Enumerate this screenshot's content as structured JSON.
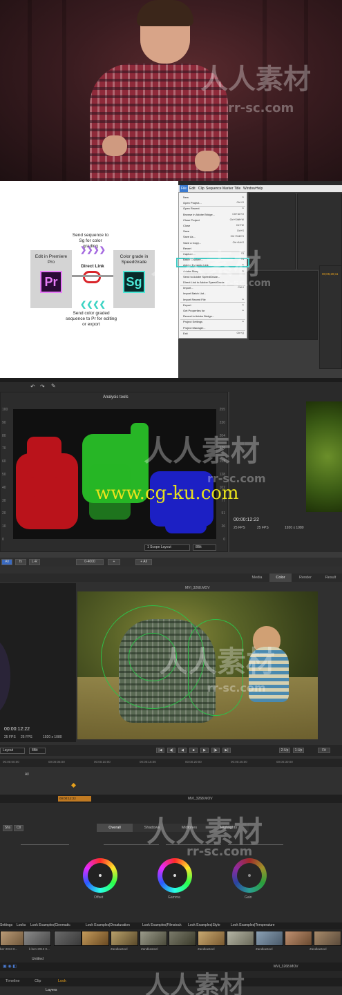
{
  "watermark": {
    "chinese": "人人素材",
    "url": "rr-sc.com",
    "overlay_url": "www.cg-ku.com"
  },
  "premiere": {
    "diagram": {
      "send_top": "Send sequence to Sg for color grading",
      "edit_in": "Edit in Premiere Pro",
      "direct_link": "Direct Link",
      "color_grade_in": "Color grade in SpeedGrade",
      "send_bottom": "Send color graded sequence to Pr for editing or export",
      "pr_icon": "Pr",
      "sg_icon": "Sg"
    },
    "menubar": [
      "File",
      "Edit",
      "Clip",
      "Sequence",
      "Marker",
      "Title",
      "Window",
      "Help"
    ],
    "file_menu": [
      {
        "label": "New",
        "shortcut": "▸"
      },
      {
        "label": "Open Project...",
        "shortcut": "Ctrl+O"
      },
      {
        "label": "Open Recent",
        "shortcut": "▸"
      },
      {
        "label": "Browse in Adobe Bridge...",
        "shortcut": "Ctrl+Alt+O"
      },
      {
        "label": "Close Project",
        "shortcut": "Ctrl+Shift+W"
      },
      {
        "label": "Close",
        "shortcut": "Ctrl+W"
      },
      {
        "label": "Save",
        "shortcut": "Ctrl+S"
      },
      {
        "label": "Save As...",
        "shortcut": "Ctrl+Shift+S"
      },
      {
        "label": "Save a Copy...",
        "shortcut": "Ctrl+Alt+S"
      },
      {
        "label": "Revert",
        "shortcut": ""
      },
      {
        "label": "Capture...",
        "shortcut": "F5"
      },
      {
        "label": "Batch Capture...",
        "shortcut": "F6"
      },
      {
        "label": "Adobe Dynamic Link",
        "shortcut": "▸"
      },
      {
        "label": "Adobe Story",
        "shortcut": "▸"
      },
      {
        "label": "Send to Adobe SpeedGrade...",
        "shortcut": ""
      },
      {
        "label": "Direct Link to Adobe SpeedGrade",
        "shortcut": ""
      },
      {
        "label": "Import...",
        "shortcut": "Ctrl+I"
      },
      {
        "label": "Import Batch List...",
        "shortcut": ""
      },
      {
        "label": "Import Recent File",
        "shortcut": "▸"
      },
      {
        "label": "Export",
        "shortcut": "▸"
      },
      {
        "label": "Get Properties for",
        "shortcut": "▸"
      },
      {
        "label": "Reveal in Adobe Bridge...",
        "shortcut": ""
      },
      {
        "label": "Project Settings",
        "shortcut": "▸"
      },
      {
        "label": "Project Manager...",
        "shortcut": ""
      },
      {
        "label": "Exit",
        "shortcut": "Ctrl+Q"
      }
    ],
    "timecode": "00;05;28;11"
  },
  "speedgrade_scopes": {
    "panel_title": "Analysis tools",
    "axis_left": [
      "100",
      "90",
      "80",
      "70",
      "60",
      "50",
      "40",
      "30",
      "20",
      "10",
      "0"
    ],
    "axis_right": [
      "255",
      "230",
      "204",
      "179",
      "153",
      "128",
      "102",
      "77",
      "51",
      "26",
      "0"
    ],
    "layout_select": "1 Scope Layout",
    "bit_select": "8Bit",
    "timecode": "00:00:12:22",
    "fps1": "25 FPS",
    "fps2": "25 FPS",
    "resolution": "1920 x 1080",
    "toolbar": [
      "All",
      "fx",
      "L-R",
      "0-4000",
      "+",
      "+ All"
    ]
  },
  "speedgrade_monitor": {
    "tabs": [
      "Media",
      "Color",
      "Render",
      "Result"
    ],
    "clip_name": "MVI_3268.MOV",
    "timecode": "00:00:12:22",
    "fps1": "25 FPS",
    "fps2": "25 FPS",
    "resolution": "1920 x 1080",
    "layout_select": "Layout",
    "bit_select": "8Bit",
    "view_options": [
      "2-Up",
      "1-Up",
      "Fit"
    ],
    "ruler": [
      "00:00:00:00",
      "00:00:05:00",
      "00:00:10:00",
      "00:00:15:00",
      "00:00:20:00",
      "00:00:25:00",
      "00:00:30:00"
    ],
    "timeline_all": "All"
  },
  "grading": {
    "clip_bar": "00:00:12:22",
    "clip_name": "MVI_3268.MOV",
    "left_tabs": [
      "Shs",
      "Ctl"
    ],
    "tabs": [
      "Overall",
      "Shadows",
      "Midtones",
      "Highlights"
    ],
    "wheel_labels": [
      "Offset",
      "Gamma",
      "Gain"
    ]
  },
  "looks": {
    "tabs": [
      "Settings",
      "Looks",
      "Look Examples|Cinematic",
      "Look Examples|Desaturation",
      "Look Examples|Filmstock",
      "Look Examples|Style",
      "Look Examples|Temperature"
    ],
    "thumb_labels": [
      "ber 2013 0...",
      "k ben 2013 0...",
      "Zandkasteel",
      "Zandkasteel",
      "Zandkasteel",
      "Zandkasteel",
      "Zandkasteel"
    ],
    "untitled": "Untitled",
    "bottom_tabs": [
      "Timeline",
      "Clip",
      "Look"
    ],
    "layers": "Layers",
    "clip_label": "MVI_3268.MOV"
  }
}
